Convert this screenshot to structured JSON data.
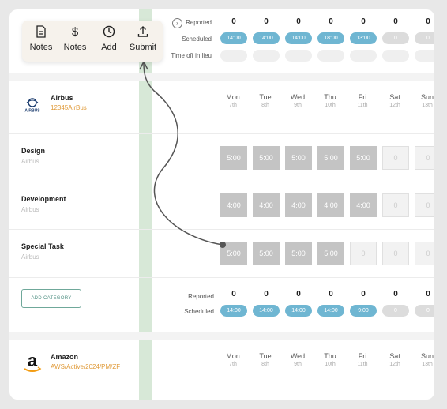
{
  "toolbar": {
    "notes1_label": "Notes",
    "notes2_label": "Notes",
    "add_label": "Add",
    "submit_label": "Submit"
  },
  "top_summary": {
    "reported_label": "Reported",
    "scheduled_label": "Scheduled",
    "lieu_label": "Time off in lieu",
    "reported": [
      "0",
      "0",
      "0",
      "0",
      "0",
      "0",
      "0"
    ],
    "scheduled": [
      "14:00",
      "14:00",
      "14:00",
      "18:00",
      "13:00",
      "0",
      "0"
    ]
  },
  "airbus": {
    "name": "Airbus",
    "code": "12345AirBus",
    "logo_text": "AIRBUS",
    "days": [
      "Mon",
      "Tue",
      "Wed",
      "Thu",
      "Fri",
      "Sat",
      "Sun"
    ],
    "dates": [
      "7th",
      "8th",
      "9th",
      "10th",
      "11th",
      "12th",
      "13th"
    ],
    "tasks": [
      {
        "title": "Design",
        "client": "Airbus",
        "hours": [
          "5:00",
          "5:00",
          "5:00",
          "5:00",
          "5:00",
          "0",
          "0"
        ]
      },
      {
        "title": "Development",
        "client": "Airbus",
        "hours": [
          "4:00",
          "4:00",
          "4:00",
          "4:00",
          "4:00",
          "0",
          "0"
        ]
      },
      {
        "title": "Special Task",
        "client": "Airbus",
        "hours": [
          "5:00",
          "5:00",
          "5:00",
          "5:00",
          "0",
          "0",
          "0"
        ]
      }
    ],
    "add_category_label": "ADD CATEGORY",
    "reported_label": "Reported",
    "scheduled_label": "Scheduled",
    "reported": [
      "0",
      "0",
      "0",
      "0",
      "0",
      "0",
      "0"
    ],
    "scheduled": [
      "14:00",
      "14:00",
      "14:00",
      "14:00",
      "9:00",
      "0",
      "0"
    ]
  },
  "amazon": {
    "name": "Amazon",
    "code": "AWS/Active/2024/PM/ZF",
    "days": [
      "Mon",
      "Tue",
      "Wed",
      "Thu",
      "Fri",
      "Sat",
      "Sun"
    ],
    "dates": [
      "7th",
      "8th",
      "9th",
      "10th",
      "11th",
      "12th",
      "13th"
    ]
  },
  "colors": {
    "accent": "#6fb6d2",
    "code_orange": "#e09b3a",
    "strip_green": "#d7e8d7",
    "button_teal": "#4f8f82"
  }
}
